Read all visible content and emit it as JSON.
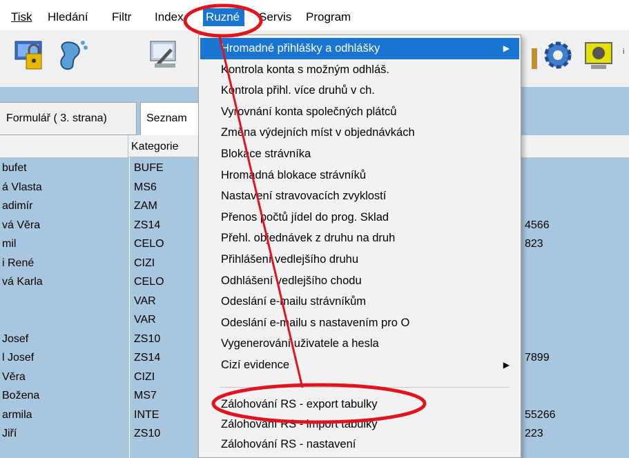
{
  "menubar": [
    {
      "label": "Tisk"
    },
    {
      "label": "Hledání"
    },
    {
      "label": "Filtr"
    },
    {
      "label": "Index"
    },
    {
      "label": "Ruzné"
    },
    {
      "label": "Servis"
    },
    {
      "label": "Program"
    }
  ],
  "tabs": {
    "form": "Formulář ( 3. strana)",
    "list": "Seznam"
  },
  "grid": {
    "category_header": "Kategorie",
    "names": [
      "bufet",
      "á Vlasta",
      "adimír",
      "vá Věra",
      "mil",
      "i René",
      "vá Karla",
      "",
      "",
      "Josef",
      "l Josef",
      "Věra",
      "Božena",
      "armila",
      "Jiří"
    ],
    "categories": [
      "BUFE",
      "MS6",
      "ZAM",
      "ZS14",
      "CELO",
      "CIZI",
      "CELO",
      "VAR",
      "VAR",
      "ZS10",
      "ZS14",
      "CIZI",
      "MS7",
      "INTE",
      "ZS10"
    ],
    "right_values": [
      "",
      "",
      "",
      "4566",
      "823",
      "",
      "",
      "",
      "",
      "",
      "7899",
      "",
      "",
      "55266",
      "223"
    ]
  },
  "menu": {
    "items": [
      {
        "label": "Hromadné přihlášky a odhlášky",
        "submenu": true
      },
      {
        "label": "Kontrola konta s možným odhláš."
      },
      {
        "label": "Kontrola přihl. více druhů v ch."
      },
      {
        "label": "Vyrovnání konta společných plátců"
      },
      {
        "label": "Změna výdejních míst v objednávkách"
      },
      {
        "label": "Blokace strávníka"
      },
      {
        "label": "Hromadná blokace strávníků"
      },
      {
        "label": "Nastavení stravovacích zvyklostí"
      },
      {
        "label": "Přenos počtů jídel do prog. Sklad"
      },
      {
        "label": "Přehl. objednávek z druhu na druh"
      },
      {
        "label": "Přihlášení vedlejšího druhu"
      },
      {
        "label": "Odhlášení vedlejšího chodu"
      },
      {
        "label": "Odeslání e-mailu strávníkům"
      },
      {
        "label": "Odeslání e-mailu s nastavením pro O"
      },
      {
        "label": "Vygenerování uživatele a hesla"
      },
      {
        "label": "Cizí evidence",
        "submenu": true
      }
    ],
    "items2": [
      {
        "label": "Zálohování RS - export tabulky"
      },
      {
        "label": "Zálohování RS - import tabulky"
      },
      {
        "label": "Zálohování RS - nastavení"
      }
    ]
  },
  "colors": {
    "highlight": "#1875d1",
    "annotation": "#e0141e",
    "grid": "#a9c6df"
  },
  "icons": [
    "lock-computer-icon",
    "footprint-icon",
    "wrench-computer-icon",
    "gear-icon",
    "monitor-icon"
  ]
}
